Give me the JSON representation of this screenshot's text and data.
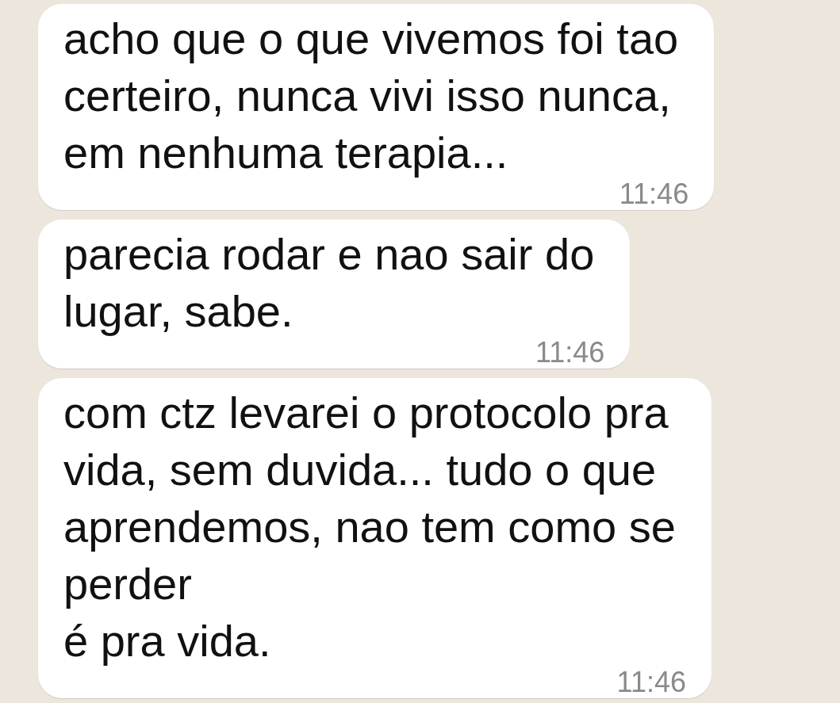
{
  "messages": [
    {
      "text": "acho que o que vivemos foi tao\ncerteiro, nunca vivi isso nunca,\nem nenhuma terapia...",
      "time": "11:46"
    },
    {
      "text": "parecia rodar e nao sair do\nlugar, sabe.",
      "time": "11:46"
    },
    {
      "text": "com ctz levarei o protocolo pra\nvida, sem duvida... tudo o que\naprendemos, nao tem como se\nperder\né pra vida.",
      "time": "11:46"
    }
  ]
}
